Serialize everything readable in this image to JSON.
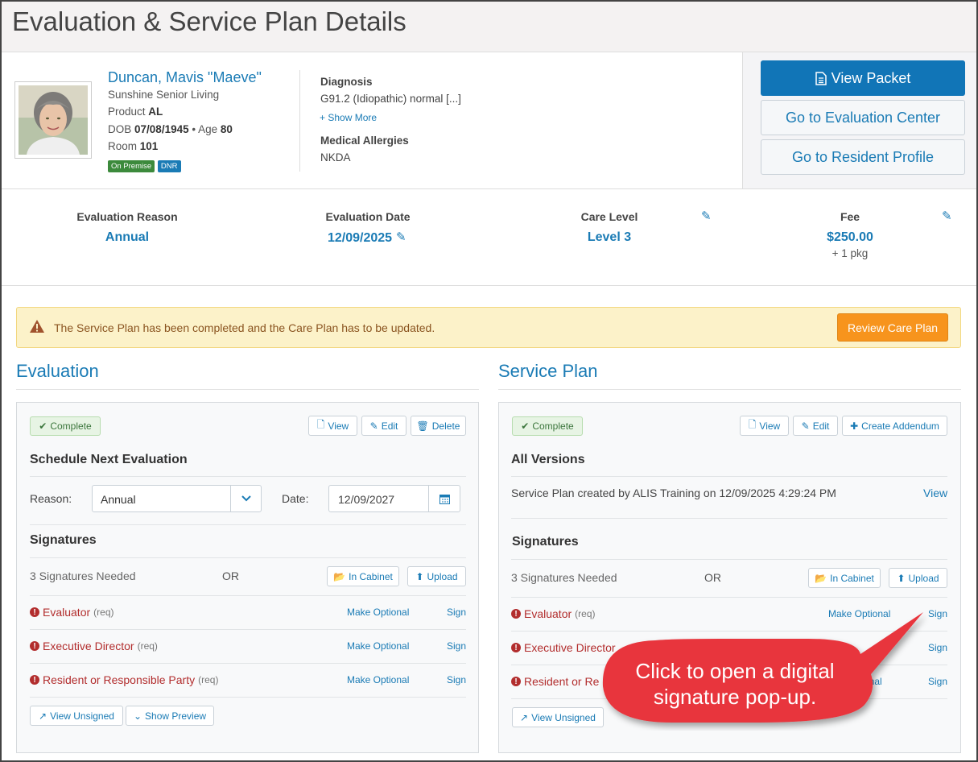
{
  "page": {
    "title": "Evaluation & Service Plan Details"
  },
  "resident": {
    "name": "Duncan, Mavis \"Maeve\"",
    "facility": "Sunshine Senior Living",
    "product_label": "Product",
    "product_value": "AL",
    "dob_label": "DOB",
    "dob_value": "07/08/1945",
    "separator": "•",
    "age_label": "Age",
    "age_value": "80",
    "room_label": "Room",
    "room_value": "101",
    "badges": [
      "On Premise",
      "DNR"
    ]
  },
  "diagnosis": {
    "heading": "Diagnosis",
    "value": "G91.2 (Idiopathic) normal [...]",
    "show_more": "Show More",
    "allergies_heading": "Medical Allergies",
    "allergies_value": "NKDA"
  },
  "actions": {
    "view_packet": "View Packet",
    "evaluation_center": "Go to Evaluation Center",
    "resident_profile": "Go to Resident Profile"
  },
  "stats": {
    "reason_label": "Evaluation Reason",
    "reason_value": "Annual",
    "date_label": "Evaluation Date",
    "date_value": "12/09/2025",
    "care_label": "Care Level",
    "care_value": "Level 3",
    "fee_label": "Fee",
    "fee_value": "$250.00",
    "fee_sub": "+ 1 pkg"
  },
  "alert": {
    "text": "The Service Plan has been completed and the Care Plan has to be updated.",
    "button": "Review Care Plan"
  },
  "evaluation": {
    "title": "Evaluation",
    "status": "Complete",
    "view": "View",
    "edit": "Edit",
    "delete": "Delete",
    "schedule_title": "Schedule Next Evaluation",
    "reason_label": "Reason:",
    "reason_value": "Annual",
    "date_label": "Date:",
    "date_value": "12/09/2027",
    "signatures_title": "Signatures",
    "needed": "3 Signatures Needed",
    "or": "OR",
    "in_cabinet": "In Cabinet",
    "upload": "Upload",
    "signers": [
      {
        "role": "Evaluator",
        "req": "(req)",
        "optional": "Make Optional",
        "sign": "Sign"
      },
      {
        "role": "Executive Director",
        "req": "(req)",
        "optional": "Make Optional",
        "sign": "Sign"
      },
      {
        "role": "Resident or Responsible Party",
        "req": "(req)",
        "optional": "Make Optional",
        "sign": "Sign"
      }
    ],
    "view_unsigned": "View Unsigned",
    "show_preview": "Show Preview"
  },
  "service_plan": {
    "title": "Service Plan",
    "status": "Complete",
    "view": "View",
    "edit": "Edit",
    "create_addendum": "Create Addendum",
    "versions_title": "All Versions",
    "created_text": "Service Plan created by ALIS Training on 12/09/2025 4:29:24 PM",
    "version_view": "View",
    "signatures_title": "Signatures",
    "needed": "3 Signatures Needed",
    "or": "OR",
    "in_cabinet": "In Cabinet",
    "upload": "Upload",
    "signers": [
      {
        "role": "Evaluator",
        "req": "(req)",
        "optional": "Make Optional",
        "sign": "Sign"
      },
      {
        "role": "Executive Director",
        "sign": "Sign"
      },
      {
        "role": "Resident or Re",
        "optional": "onal",
        "sign": "Sign"
      }
    ],
    "view_unsigned": "View Unsigned"
  },
  "callout": {
    "text": "Click to open a digital signature pop-up.",
    "color": "#e8353d"
  }
}
